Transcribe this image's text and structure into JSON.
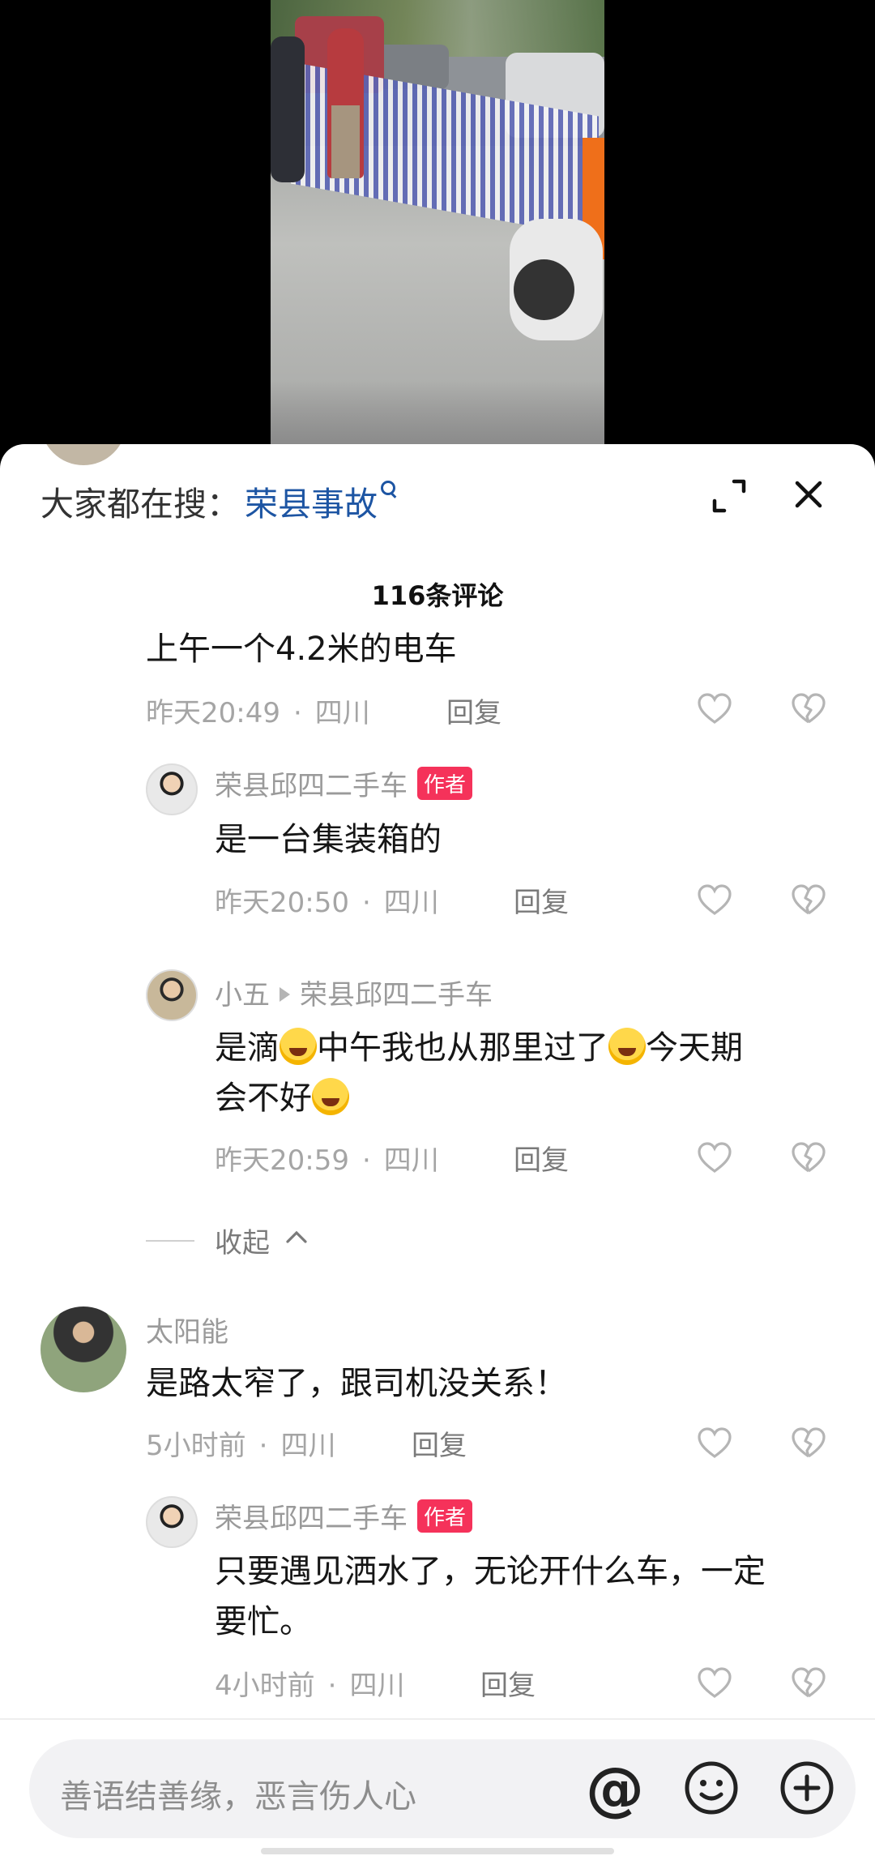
{
  "search": {
    "prefix": "大家都在搜：",
    "term": "荣县事故"
  },
  "comment_count": "116条评论",
  "comments": [
    {
      "text": "上午一个4.2米的电车",
      "time": "昨天20:49",
      "location": "四川",
      "reply": "回复"
    },
    {
      "name": "荣县邱四二手车",
      "badge": "作者",
      "text": "是一台集装箱的",
      "time": "昨天20:50",
      "location": "四川",
      "reply": "回复"
    },
    {
      "name": "小五",
      "target": "荣县邱四二手车",
      "text_parts": [
        "是滴",
        "中午我也从那里过了",
        "今天期",
        "会不好"
      ],
      "time": "昨天20:59",
      "location": "四川",
      "reply": "回复"
    },
    {
      "name": "太阳能",
      "text": "是路太窄了，跟司机没关系！",
      "time": "5小时前",
      "location": "四川",
      "reply": "回复"
    },
    {
      "name": "荣县邱四二手车",
      "badge": "作者",
      "text_line1": "只要遇见洒水了，无论开什么车，一定",
      "text_line2": "要忙。",
      "time": "4小时前",
      "location": "四川",
      "reply": "回复"
    }
  ],
  "collapse_label": "收起",
  "dot": "·",
  "input": {
    "placeholder": "善语结善缘，恶言伤人心",
    "at": "@"
  },
  "colors": {
    "link": "#1d55a3",
    "badge": "#f5325a"
  }
}
